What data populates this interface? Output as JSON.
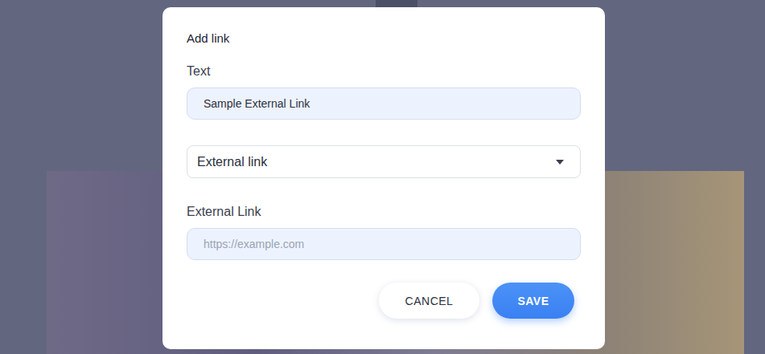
{
  "dialog": {
    "title": "Add link"
  },
  "text_field": {
    "label": "Text",
    "value": "Sample External Link"
  },
  "link_type": {
    "value": "External link",
    "expanded": false
  },
  "url_field": {
    "label": "External Link",
    "placeholder": "https://example.com",
    "value": ""
  },
  "buttons": [
    {
      "label": "CANCEL",
      "kind": "secondary"
    },
    {
      "label": "SAVE",
      "kind": "primary"
    }
  ]
}
